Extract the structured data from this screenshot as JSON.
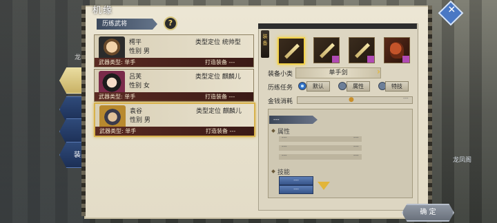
{
  "window": {
    "title": "机缘"
  },
  "side": {
    "left_tab_label": "装",
    "left_top_label": "龙",
    "right_label": "龙凤阁"
  },
  "section": {
    "header": "历练武将",
    "help": "?"
  },
  "heroes": [
    {
      "name": "樗平",
      "gender": "性别 男",
      "type": "类型定位 统帅型",
      "weapon": "武器类型: 单手",
      "forge": "打造装备 ---"
    },
    {
      "name": "吕芙",
      "gender": "性别 女",
      "type": "类型定位 麒麟儿",
      "weapon": "武器类型: 单手",
      "forge": "打造装备 ---"
    },
    {
      "name": "袁谷",
      "gender": "性别 男",
      "type": "类型定位 麒麟儿",
      "weapon": "武器类型: 单手",
      "forge": "打造装备 ---"
    }
  ],
  "equipment": {
    "pendant": "装备",
    "subclass_label": "装备小类",
    "subclass_value": "单手剑",
    "task_label": "历练任务",
    "task_options": [
      "默认",
      "属性",
      "特技"
    ],
    "money_label": "金钱消耗",
    "money_value": "---"
  },
  "stats": {
    "header": "---",
    "attr_label": "属性",
    "attr_rows": [
      [
        "---",
        "---"
      ],
      [
        "---",
        "---"
      ],
      [
        "---",
        "---"
      ]
    ],
    "skill_label": "技能",
    "skill_buttons": [
      "---",
      "---"
    ]
  },
  "footer": {
    "confirm": "确 定"
  },
  "colors": {
    "accent_gold": "#f3d24a",
    "footer_dark": "#5a2a22",
    "tab_blue": "#2f4a7a"
  }
}
